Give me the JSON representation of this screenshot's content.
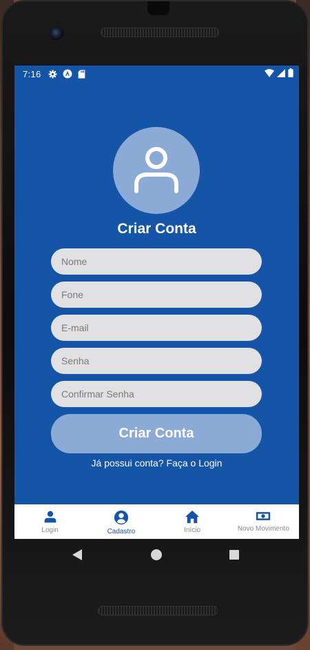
{
  "status_bar": {
    "time": "7:16",
    "left_icons": [
      "settings-icon",
      "vpn-key-icon",
      "sd-card-icon"
    ],
    "right_icons": [
      "wifi-icon",
      "signal-icon",
      "battery-icon"
    ]
  },
  "header": {
    "avatar_icon": "user-icon",
    "title": "Criar Conta"
  },
  "form": {
    "name_placeholder": "Nome",
    "phone_placeholder": "Fone",
    "email_placeholder": "E-mail",
    "password_placeholder": "Senha",
    "confirm_password_placeholder": "Confirmar Senha",
    "submit_label": "Criar Conta",
    "login_link": "Já possui conta? Faça o Login"
  },
  "bottom_nav": {
    "items": [
      {
        "label": "Login",
        "icon": "person-icon",
        "active": false
      },
      {
        "label": "Cadastro",
        "icon": "account-circle-icon",
        "active": true
      },
      {
        "label": "Início",
        "icon": "home-icon",
        "active": false
      },
      {
        "label": "Novo Movimento",
        "icon": "cash-icon",
        "active": false
      }
    ]
  },
  "colors": {
    "primary": "#1555a8",
    "avatar_bg": "#8caad6",
    "input_bg": "#e1e1e3",
    "nav_inactive": "#8a8a8a"
  }
}
